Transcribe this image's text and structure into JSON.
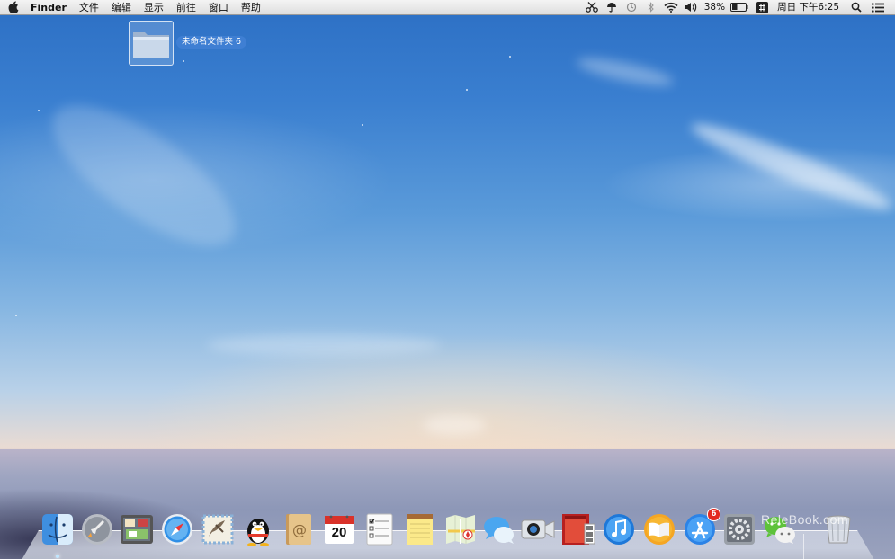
{
  "menubar": {
    "app_name": "Finder",
    "menus": [
      "文件",
      "编辑",
      "显示",
      "前往",
      "窗口",
      "帮助"
    ],
    "status": {
      "battery_percent": "38%",
      "clock": "周日 下午6:25"
    },
    "icons": [
      "apple-icon",
      "scissors-icon",
      "umbrella-icon",
      "time-machine-icon",
      "bluetooth-icon",
      "wifi-icon",
      "volume-icon",
      "battery-icon",
      "input-method-icon",
      "spotlight-icon",
      "notification-center-icon"
    ]
  },
  "desktop": {
    "folder_name": "未命名文件夹 6"
  },
  "dock": {
    "items": [
      {
        "name": "finder-icon",
        "running": true
      },
      {
        "name": "launchpad-icon",
        "running": false
      },
      {
        "name": "mission-control-icon",
        "running": false
      },
      {
        "name": "safari-icon",
        "running": false
      },
      {
        "name": "mail-icon",
        "running": false
      },
      {
        "name": "qq-icon",
        "running": false
      },
      {
        "name": "contacts-icon",
        "running": false
      },
      {
        "name": "calendar-icon",
        "running": false,
        "label": "20"
      },
      {
        "name": "reminders-icon",
        "running": false
      },
      {
        "name": "notes-icon",
        "running": false
      },
      {
        "name": "maps-icon",
        "running": false
      },
      {
        "name": "messages-icon",
        "running": false
      },
      {
        "name": "facetime-icon",
        "running": false
      },
      {
        "name": "photo-booth-icon",
        "running": false
      },
      {
        "name": "itunes-icon",
        "running": false
      },
      {
        "name": "ibooks-icon",
        "running": false
      },
      {
        "name": "app-store-icon",
        "running": false,
        "badge": "6"
      },
      {
        "name": "system-preferences-icon",
        "running": false
      },
      {
        "name": "wechat-icon",
        "running": false
      },
      {
        "name": "trash-icon",
        "running": false
      }
    ]
  },
  "watermark": "ReleBook.com"
}
